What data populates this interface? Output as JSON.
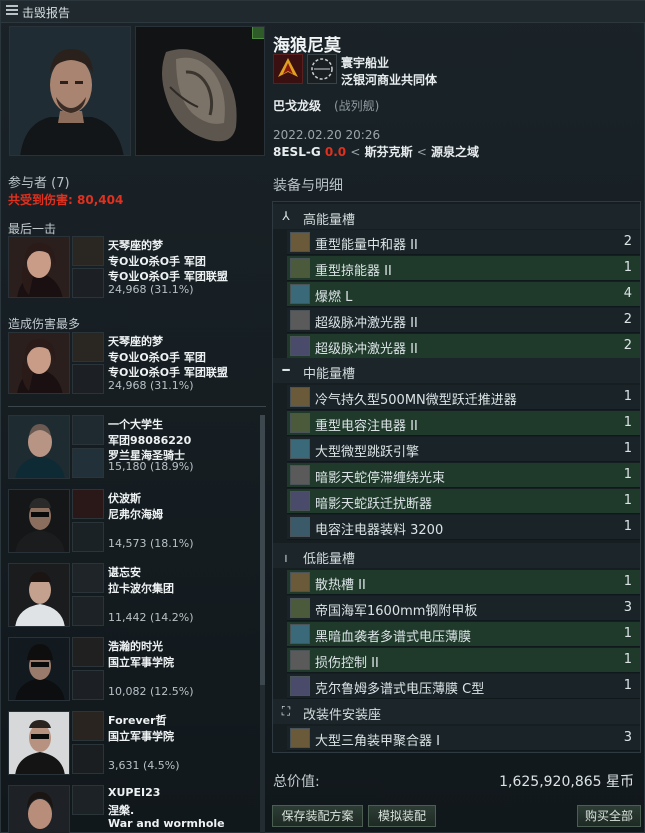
{
  "window": {
    "title": "击毁报告"
  },
  "victim": {
    "name": "海狼尼莫",
    "corporation": "寰宇船业",
    "alliance": "泛银河商业共同体",
    "ship_type": "巴戈龙级",
    "ship_class": "(战列舰)",
    "time": "2022.02.20 20:26",
    "location": {
      "system": "8ESL-G",
      "security": "0.0",
      "constellation": "斯芬克斯",
      "region": "源泉之域",
      "separator": "<"
    }
  },
  "participants": {
    "header": "参与者 (7)",
    "total_damage_label": "共受到伤害:",
    "total_damage": "80,404",
    "final_blow_label": "最后一击",
    "top_damage_label": "造成伤害最多",
    "final_blow": {
      "name": "天琴座的梦",
      "corp": "专O业O杀O手 军团",
      "alliance": "专O业O杀O手 军团联盟",
      "damage": "24,968 (31.1%)"
    },
    "top_damage": {
      "name": "天琴座的梦",
      "corp": "专O业O杀O手 军团",
      "alliance": "专O业O杀O手 军团联盟",
      "damage": "24,968 (31.1%)"
    },
    "list": [
      {
        "name": "一个大学生",
        "corp": "军团98086220",
        "alliance": "罗兰星海圣骑士",
        "damage": "15,180 (18.9%)"
      },
      {
        "name": "伏波斯",
        "corp": "尼弗尔海姆",
        "alliance": "",
        "damage": "14,573 (18.1%)"
      },
      {
        "name": "谌忘安",
        "corp": "拉卡波尔集团",
        "alliance": "",
        "damage": "11,442 (14.2%)"
      },
      {
        "name": "浩瀚的时光",
        "corp": "国立军事学院",
        "alliance": "",
        "damage": "10,082 (12.5%)"
      },
      {
        "name": "Forever哲",
        "corp": "国立军事学院",
        "alliance": "",
        "damage": "3,631 (4.5%)"
      },
      {
        "name": "XUPEI23",
        "corp": "涅槃.",
        "alliance": "War and wormhole",
        "damage": ""
      }
    ]
  },
  "fitting": {
    "header": "装备与明细",
    "high_label": "高能量槽",
    "mid_label": "中能量槽",
    "low_label": "低能量槽",
    "rig_label": "改装件安装座",
    "high": [
      {
        "name": "重型能量中和器 II",
        "qty": "2",
        "style": "dark"
      },
      {
        "name": "重型掠能器 II",
        "qty": "1",
        "style": "green"
      },
      {
        "name": "爆燃 L",
        "qty": "4",
        "style": "green"
      },
      {
        "name": "超级脉冲激光器 II",
        "qty": "2",
        "style": "dark"
      },
      {
        "name": "超级脉冲激光器 II",
        "qty": "2",
        "style": "green"
      }
    ],
    "mid": [
      {
        "name": "冷气持久型500MN微型跃迁推进器",
        "qty": "1",
        "style": "dark"
      },
      {
        "name": "重型电容注电器 II",
        "qty": "1",
        "style": "green"
      },
      {
        "name": "大型微型跳跃引擎",
        "qty": "1",
        "style": "dark"
      },
      {
        "name": "暗影天蛇停滞缠绕光束",
        "qty": "1",
        "style": "green"
      },
      {
        "name": "暗影天蛇跃迁扰断器",
        "qty": "1",
        "style": "green"
      },
      {
        "name": "电容注电器装料 3200",
        "qty": "1",
        "style": "dark"
      }
    ],
    "low": [
      {
        "name": "散热槽 II",
        "qty": "1",
        "style": "green"
      },
      {
        "name": "帝国海军1600mm钢附甲板",
        "qty": "3",
        "style": "dark"
      },
      {
        "name": "黑暗血袭者多谱式电压薄膜",
        "qty": "1",
        "style": "green"
      },
      {
        "name": "损伤控制 II",
        "qty": "1",
        "style": "green"
      },
      {
        "name": "克尔鲁姆多谱式电压薄膜 C型",
        "qty": "1",
        "style": "dark"
      }
    ],
    "rig": [
      {
        "name": "大型三角装甲聚合器 I",
        "qty": "3",
        "style": "dark"
      }
    ],
    "total_label": "总价值:",
    "total_value": "1,625,920,865 星币"
  },
  "buttons": {
    "save_fit": "保存装配方案",
    "simulate_fit": "模拟装配",
    "buy_all": "购买全部"
  },
  "colors": {
    "security_red": "#e0301e",
    "slot_green": "#1f3a2b",
    "slot_dark": "#1a2428"
  }
}
